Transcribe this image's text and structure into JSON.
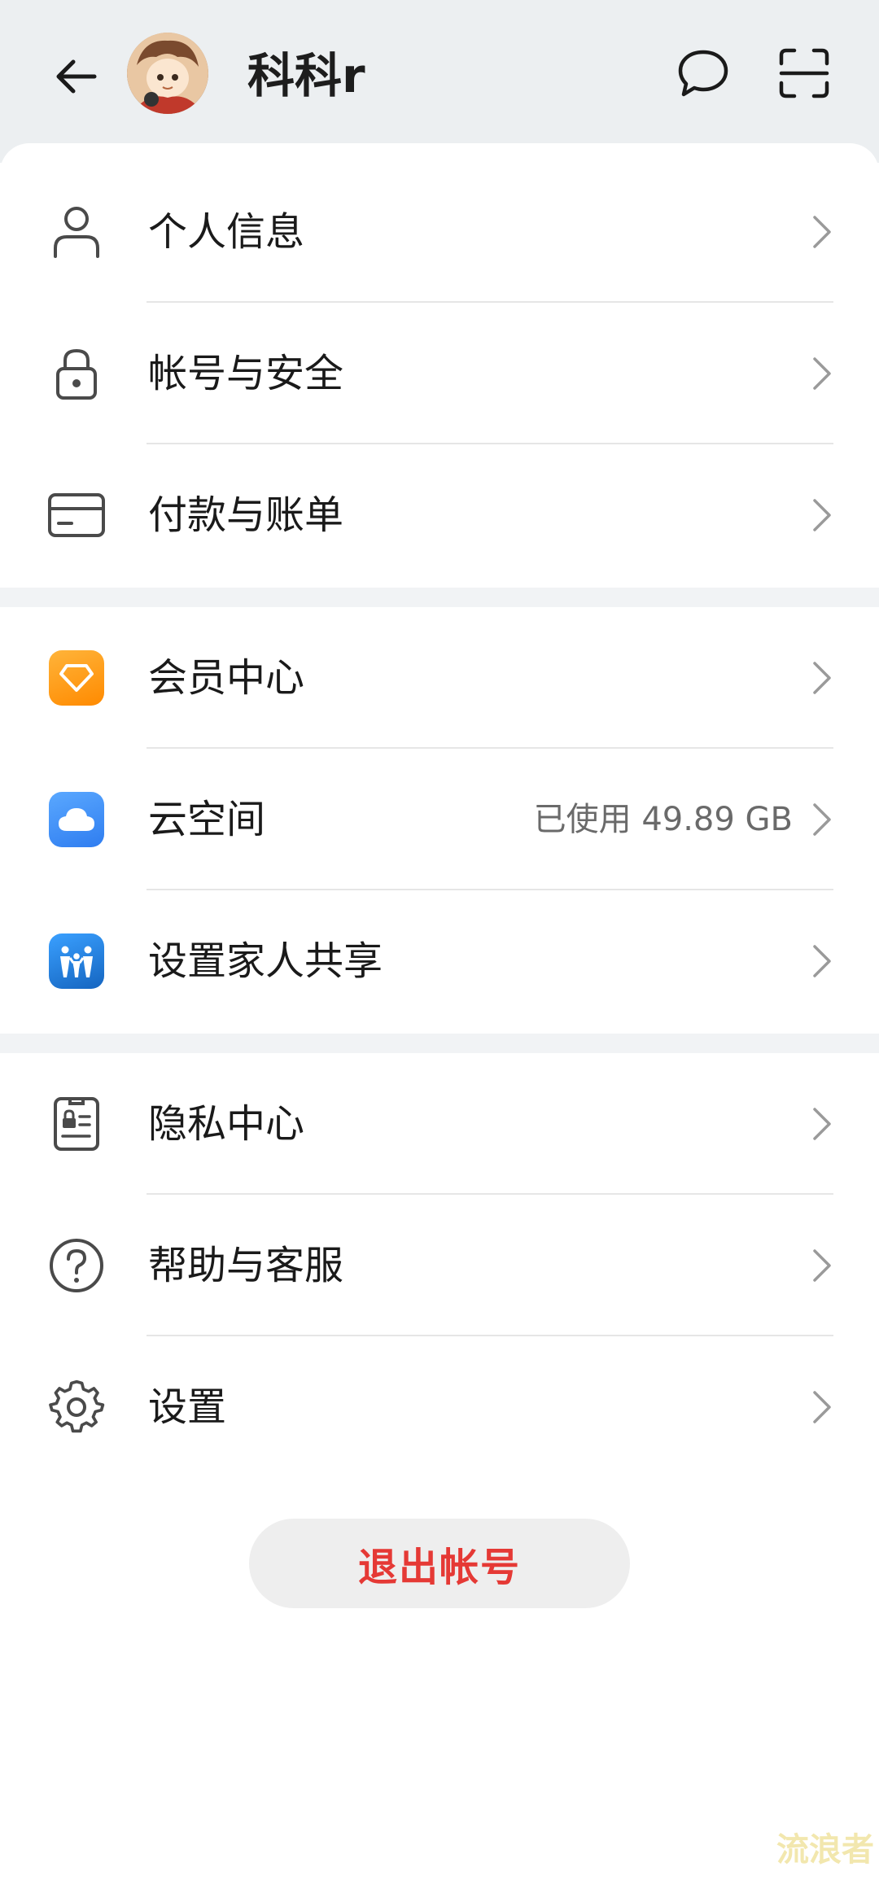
{
  "header": {
    "username": "科科r",
    "back_icon": "back-arrow-icon",
    "message_icon": "message-bubble-icon",
    "scan_icon": "scan-icon"
  },
  "sections": [
    {
      "items": [
        {
          "label": "个人信息",
          "icon": "person-icon",
          "value": ""
        },
        {
          "label": "帐号与安全",
          "icon": "lock-icon",
          "value": ""
        },
        {
          "label": "付款与账单",
          "icon": "card-icon",
          "value": ""
        }
      ]
    },
    {
      "items": [
        {
          "label": "会员中心",
          "icon": "diamond-icon",
          "value": "",
          "color": "#ff9f1c"
        },
        {
          "label": "云空间",
          "icon": "cloud-icon",
          "value": "已使用 49.89 GB",
          "color": "#3d8bfd"
        },
        {
          "label": "设置家人共享",
          "icon": "family-icon",
          "value": "",
          "color": "#1e88e5"
        }
      ]
    },
    {
      "items": [
        {
          "label": "隐私中心",
          "icon": "privacy-badge-icon",
          "value": ""
        },
        {
          "label": "帮助与客服",
          "icon": "help-icon",
          "value": ""
        },
        {
          "label": "设置",
          "icon": "gear-icon",
          "value": ""
        }
      ]
    }
  ],
  "logout_label": "退出帐号",
  "watermark": "流浪者",
  "colors": {
    "header_bg": "#eceff1",
    "logout_text": "#e53935",
    "section_gap": "#f1f3f5"
  }
}
